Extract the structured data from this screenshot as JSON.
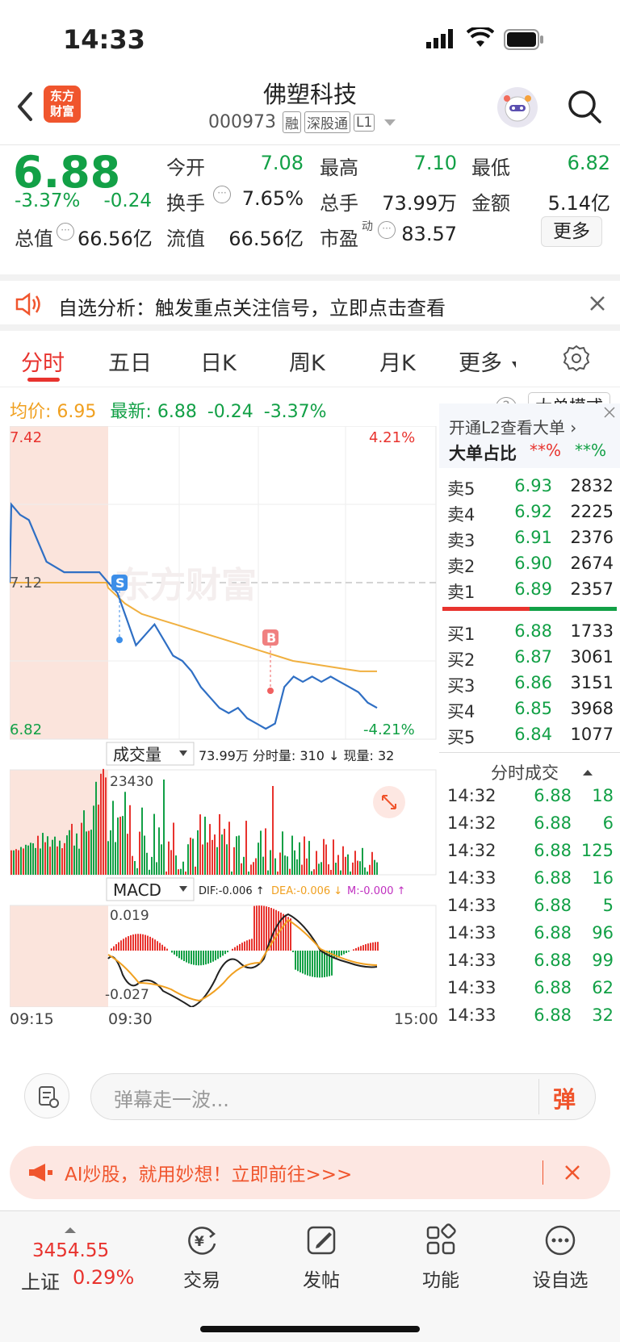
{
  "status": {
    "time": "14:33"
  },
  "header": {
    "logo_text": "东方财富",
    "stock_name": "佛塑科技",
    "stock_code": "000973",
    "tags": [
      "融",
      "深股通",
      "L1"
    ]
  },
  "quote": {
    "price": "6.88",
    "change_pct": "-3.37%",
    "change": "-0.24",
    "market_cap_label": "总值",
    "market_cap": "66.56亿",
    "fields": [
      {
        "label": "今开",
        "value": "7.08",
        "color": "#12a046"
      },
      {
        "label": "最高",
        "value": "7.10",
        "color": "#12a046"
      },
      {
        "label": "最低",
        "value": "6.82",
        "color": "#12a046"
      },
      {
        "label": "换手",
        "value": "7.65%",
        "color": "#222222"
      },
      {
        "label": "总手",
        "value": "73.99万",
        "color": "#222222"
      },
      {
        "label": "金额",
        "value": "5.14亿",
        "color": "#222222"
      },
      {
        "label": "流值",
        "value": "66.56亿",
        "color": "#222222"
      },
      {
        "label": "市盈",
        "value": "83.57",
        "color": "#222222"
      }
    ],
    "pe_sup": "动",
    "more_label": "更多"
  },
  "alert": {
    "text": "自选分析：触发重点关注信号，立即点击查看"
  },
  "tabs": [
    "分时",
    "五日",
    "日K",
    "周K",
    "月K",
    "更多"
  ],
  "chart_info": {
    "avg_label": "均价:",
    "avg_value": "6.95",
    "latest_label": "最新:",
    "latest_value": "6.88",
    "latest_change": "-0.24",
    "latest_pct": "-3.37%",
    "mode_button": "大单模式"
  },
  "chart_labels": {
    "y_high": "7.42",
    "y_low": "6.82",
    "y_mid": "7.12",
    "pct_high": "4.21%",
    "pct_low": "-4.21%",
    "watermark": "东方财富",
    "marker_s": "S",
    "marker_b": "B",
    "volume_label": "成交量",
    "volume_info": "73.99万  分时量: 310 ↓ 现量: 32",
    "volume_max": "23430",
    "macd_label": "MACD",
    "dif": "DIF:-0.006 ↑",
    "dea": "DEA:-0.006 ↓",
    "m": "M:-0.000 ↑",
    "macd_max": "0.019",
    "macd_min": "-0.027",
    "x_start": "09:15",
    "x_open": "09:30",
    "x_end": "15:00"
  },
  "chart_data": {
    "type": "line",
    "y_range": [
      6.82,
      7.42
    ],
    "base_price": 7.12,
    "series": [
      {
        "values": [
          7.12,
          7.27,
          7.25,
          7.24,
          7.2,
          7.16,
          7.15,
          7.14,
          7.14,
          7.14,
          7.14,
          7.14,
          7.12,
          7.1,
          7.05,
          7.0,
          7.02,
          7.04,
          7.01,
          6.98,
          6.97,
          6.95,
          6.92,
          6.9,
          6.88,
          6.87,
          6.88,
          6.86,
          6.85,
          6.84,
          6.85,
          6.92,
          6.94,
          6.93,
          6.94,
          6.93,
          6.94,
          6.93,
          6.92,
          6.91,
          6.89,
          6.88
        ]
      },
      {
        "values": [
          7.12,
          7.12,
          7.12,
          7.12,
          7.12,
          7.11,
          7.08,
          7.06,
          7.05,
          7.04,
          7.03,
          7.02,
          7.01,
          7.0,
          6.99,
          6.98,
          6.97,
          6.965,
          6.96,
          6.955,
          6.95,
          6.95
        ]
      }
    ]
  },
  "orderbook": {
    "l2_text": "开通L2查看大单 ›",
    "ratio_label": "大单占比",
    "ratio_red": "**%",
    "ratio_green": "**%",
    "asks": [
      {
        "label": "卖5",
        "price": "6.93",
        "vol": "2832"
      },
      {
        "label": "卖4",
        "price": "6.92",
        "vol": "2225"
      },
      {
        "label": "卖3",
        "price": "6.91",
        "vol": "2376"
      },
      {
        "label": "卖2",
        "price": "6.90",
        "vol": "2674"
      },
      {
        "label": "卖1",
        "price": "6.89",
        "vol": "2357"
      }
    ],
    "bids": [
      {
        "label": "买1",
        "price": "6.88",
        "vol": "1733"
      },
      {
        "label": "买2",
        "price": "6.87",
        "vol": "3061"
      },
      {
        "label": "买3",
        "price": "6.86",
        "vol": "3151"
      },
      {
        "label": "买4",
        "price": "6.85",
        "vol": "3968"
      },
      {
        "label": "买5",
        "price": "6.84",
        "vol": "1077"
      }
    ]
  },
  "ticks": {
    "title": "分时成交",
    "rows": [
      {
        "time": "14:32",
        "price": "6.88",
        "vol": "18"
      },
      {
        "time": "14:32",
        "price": "6.88",
        "vol": "6"
      },
      {
        "time": "14:32",
        "price": "6.88",
        "vol": "125"
      },
      {
        "time": "14:33",
        "price": "6.88",
        "vol": "16"
      },
      {
        "time": "14:33",
        "price": "6.88",
        "vol": "5"
      },
      {
        "time": "14:33",
        "price": "6.88",
        "vol": "96"
      },
      {
        "time": "14:33",
        "price": "6.88",
        "vol": "99"
      },
      {
        "time": "14:33",
        "price": "6.88",
        "vol": "62"
      },
      {
        "time": "14:33",
        "price": "6.88",
        "vol": "32"
      }
    ]
  },
  "comment": {
    "placeholder": "弹幕走一波...",
    "danmu": "弹"
  },
  "promo": {
    "text": "AI炒股，就用妙想！立即前往>>>"
  },
  "bottom": {
    "index_value": "3454.55",
    "index_name": "上证",
    "index_pct": "0.29%",
    "nav": [
      "交易",
      "发帖",
      "功能",
      "设自选"
    ]
  }
}
